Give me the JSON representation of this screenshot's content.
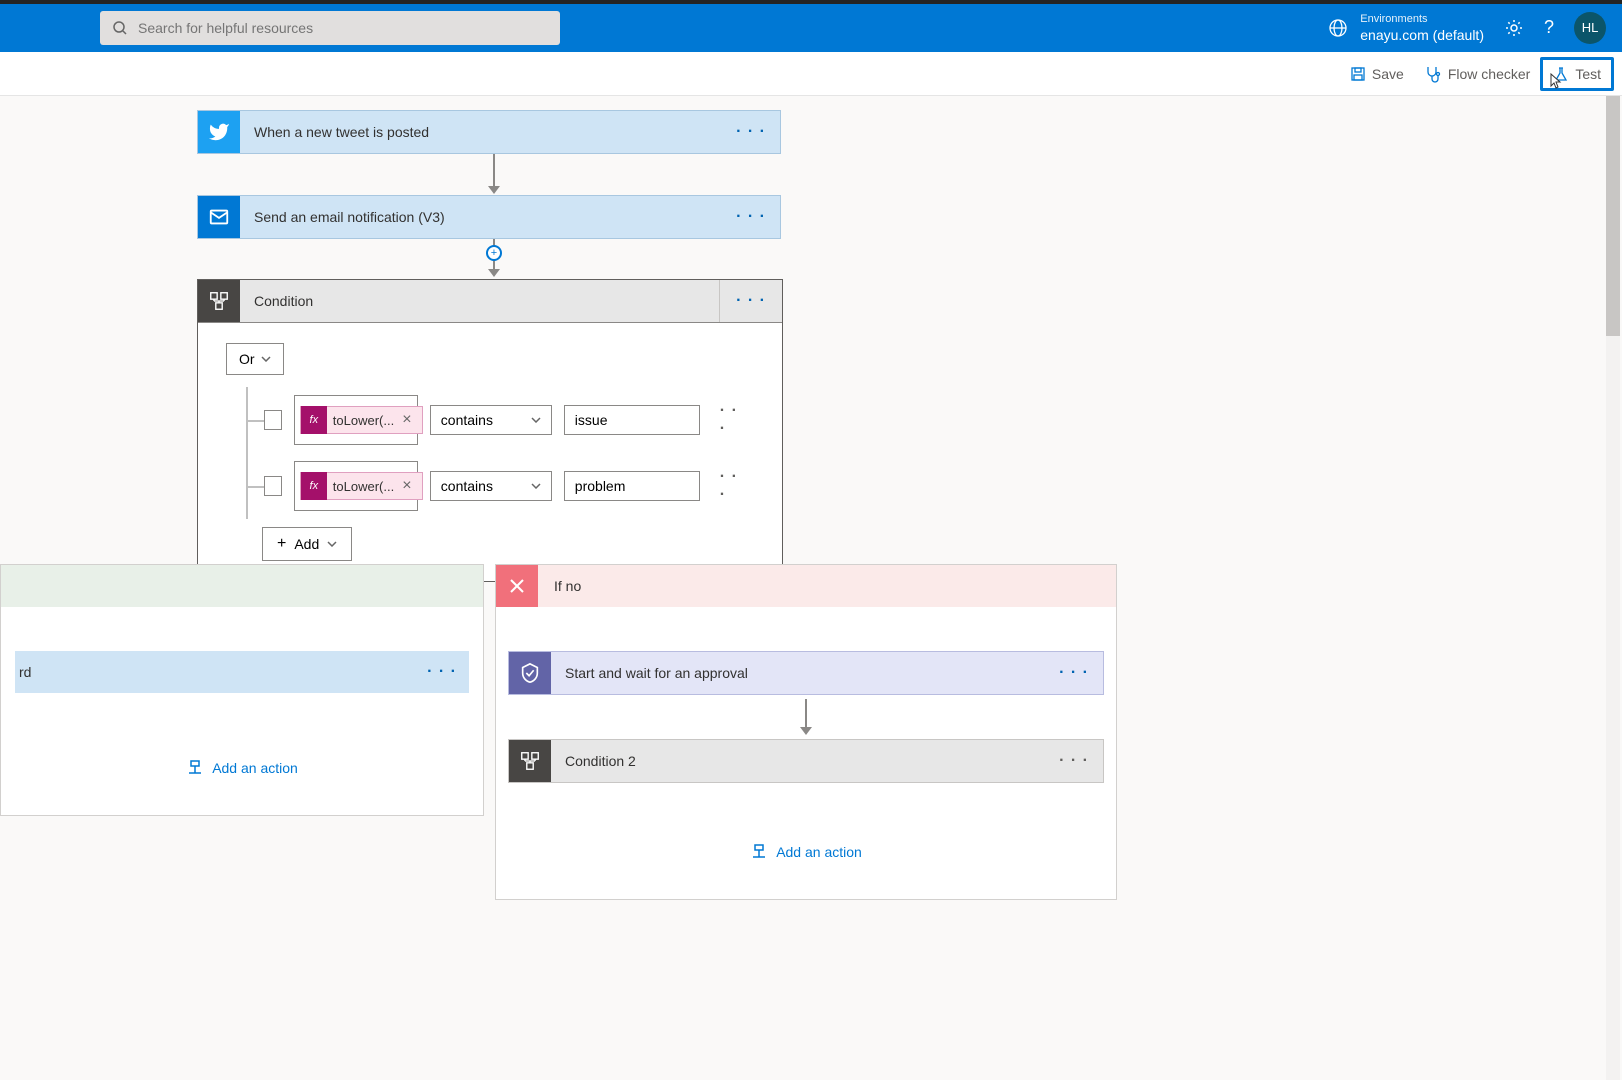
{
  "header": {
    "search_placeholder": "Search for helpful resources",
    "env_label": "Environments",
    "env_value": "enayu.com (default)",
    "avatar_initials": "HL"
  },
  "toolbar": {
    "save_label": "Save",
    "flow_checker_label": "Flow checker",
    "test_label": "Test"
  },
  "flow": {
    "trigger": {
      "title": "When a new tweet is posted"
    },
    "action1": {
      "title": "Send an email notification (V3)"
    },
    "condition": {
      "title": "Condition",
      "logic": "Or",
      "rows": [
        {
          "expr": "toLower(...",
          "operator": "contains",
          "value": "issue"
        },
        {
          "expr": "toLower(...",
          "operator": "contains",
          "value": "problem"
        }
      ],
      "add_label": "Add"
    },
    "yes_branch": {
      "partial_text": "rd",
      "add_action": "Add an action"
    },
    "no_branch": {
      "title": "If no",
      "approval_title": "Start and wait for an approval",
      "condition2_title": "Condition 2",
      "add_action": "Add an action"
    }
  }
}
